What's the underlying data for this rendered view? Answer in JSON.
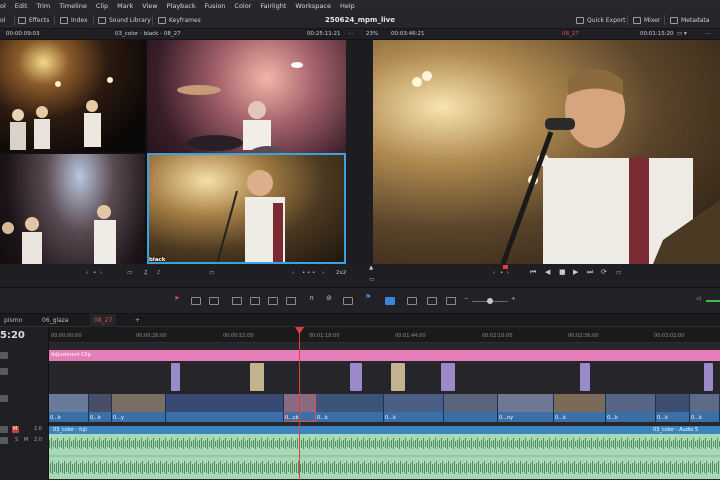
{
  "menubar": {
    "items": [
      "ol",
      "Edit",
      "Trim",
      "Timeline",
      "Clip",
      "Mark",
      "View",
      "Playback",
      "Fusion",
      "Color",
      "Fairlight",
      "Workspace",
      "Help"
    ]
  },
  "toolbar": {
    "left_cut": "ol",
    "effects": "Effects",
    "index": "Index",
    "sound_library": "Sound Library",
    "keyframes": "Keyframes",
    "project_title": "250624_mpm_live",
    "quick_export": "Quick Export",
    "mixer": "Mixer",
    "metadata": "Metadata"
  },
  "viewer_header": {
    "source_tc": "00:00:09:03",
    "source_clip": "03_color - black - 08_27",
    "source_duration": "00:25:11:21",
    "zoom": "23%",
    "program_tc_left": "00:03:46:21",
    "program_timeline": "08_27",
    "program_tc": "00:01:15:20",
    "more": "···"
  },
  "source_grid": {
    "cells": [
      {
        "tag": ""
      },
      {
        "tag": "drum"
      },
      {
        "tag": ""
      },
      {
        "tag": "black"
      }
    ],
    "layout_label": "2x2"
  },
  "transport": {
    "prev": "‹",
    "dot": "•",
    "next": "›"
  },
  "timeline_tabs": [
    {
      "label": "pismo",
      "active": false
    },
    {
      "label": "06_glaza",
      "active": false
    },
    {
      "label": "08_27",
      "active": true
    },
    {
      "label": "+",
      "active": false
    }
  ],
  "timeline": {
    "timecode": "5:20",
    "ruler": [
      "00:00:00:00",
      "00:00:26:00",
      "00:00:52:00",
      "00:01:18:00",
      "00:01:44:00",
      "00:02:10:00",
      "00:02:36:00",
      "00:03:02:00"
    ],
    "adjustment_clip": "Adjustment Clip",
    "v1_captions": [
      "0...k",
      "0...k",
      "0...y",
      "0...ck",
      "0...k",
      "0...k",
      "0...ny",
      "0...k",
      "0...k",
      "0...k",
      "0...k"
    ],
    "audio_clip_left": "03_color - fuji",
    "audio_clip_right": "03_color - Audio 5",
    "track_volume": "2.0",
    "track_volume_2": "2.0",
    "mute": "M",
    "solo": "S"
  },
  "colors": {
    "accent_red": "#e0504c",
    "selection_blue": "#3aa3e0",
    "adjustment_pink": "#e57eb8",
    "video_blue": "#3a6fa8",
    "audio_green": "#a8d8b6"
  }
}
